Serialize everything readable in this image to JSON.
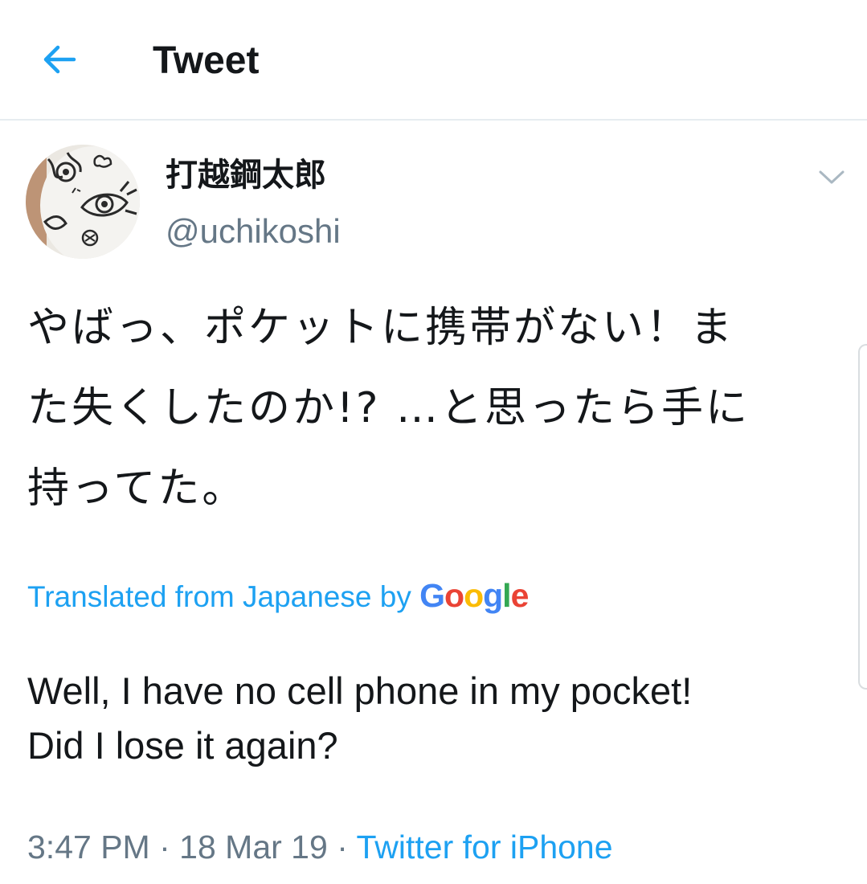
{
  "header": {
    "title": "Tweet",
    "back_icon": "arrow-left-icon"
  },
  "tweet": {
    "author": {
      "display_name": "打越鋼太郎",
      "handle": "@uchikoshi",
      "avatar": "avatar-image"
    },
    "menu_icon": "chevron-down-icon",
    "text_lines": [
      "やばっ、ポケットに携帯がない！ま",
      "た失くしたのか!? …と思ったら手に",
      "持ってた。"
    ],
    "translation_label": "Translated from Japanese by",
    "translation_provider": {
      "G": "G",
      "o1": "o",
      "o2": "o",
      "g": "g",
      "l": "l",
      "e": "e"
    },
    "translated_lines": [
      "Well, I have no cell phone in my pocket!",
      "Did I lose it again?"
    ],
    "time": "3:47 PM",
    "date": "18 Mar 19",
    "separator": "·",
    "source": "Twitter for iPhone"
  },
  "colors": {
    "accent": "#1da1f2",
    "text": "#14171a",
    "secondary": "#657786",
    "divider": "#e6ecf0",
    "google_blue": "#4285f4",
    "google_red": "#ea4335",
    "google_yellow": "#fbbc05",
    "google_green": "#34a853"
  }
}
